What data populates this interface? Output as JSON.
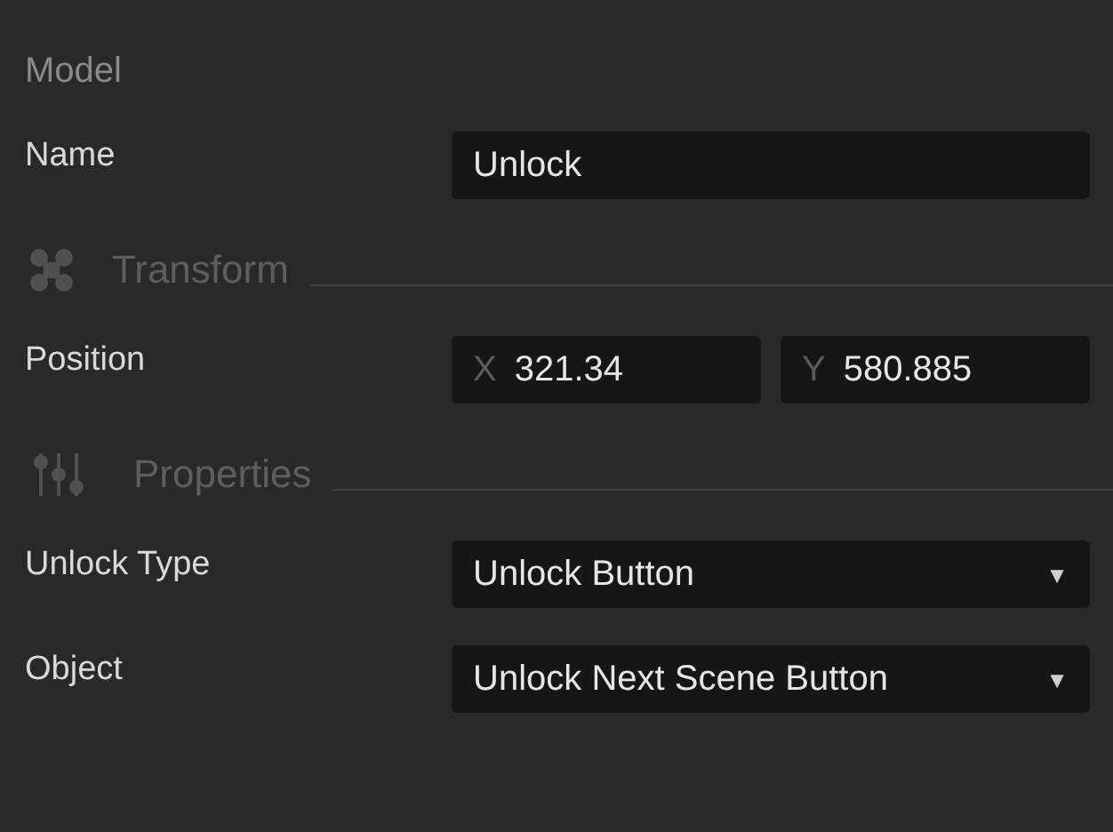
{
  "sections": [
    {
      "title": "Model",
      "kind": "plain",
      "rows": [
        {
          "label": "Name",
          "kind": "text",
          "value": "Unlock"
        }
      ]
    },
    {
      "title": "Transform",
      "kind": "transform",
      "rows": [
        {
          "label": "Position",
          "kind": "vector",
          "components": [
            {
              "axis": "X",
              "value": "321.34"
            },
            {
              "axis": "Y",
              "value": "580.885"
            }
          ]
        }
      ]
    },
    {
      "title": "Properties",
      "kind": "properties",
      "rows": [
        {
          "label": "Unlock Type",
          "kind": "select",
          "value": "Unlock Button",
          "arrow": "▼"
        },
        {
          "label": "Object",
          "kind": "select",
          "value": "Unlock Next Scene Button",
          "arrow": "▼"
        }
      ]
    }
  ]
}
